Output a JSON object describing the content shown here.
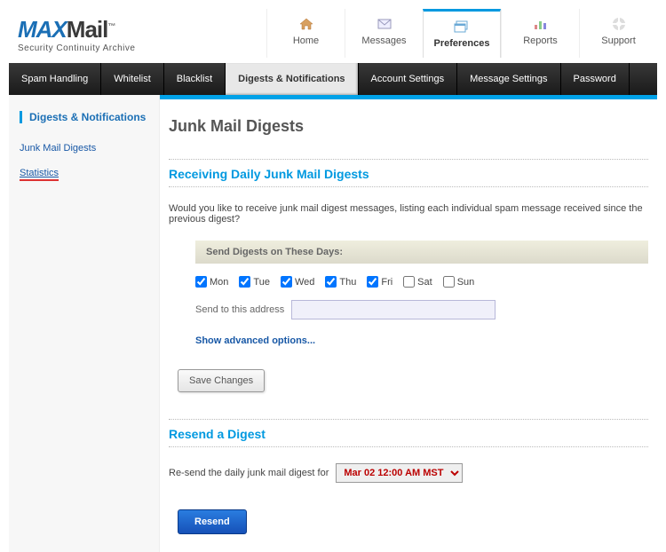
{
  "logo": {
    "part1": "MAX",
    "part2": "Mail",
    "tm": "™",
    "tagline": "Security  Continuity  Archive"
  },
  "topnav": {
    "items": [
      {
        "label": "Home"
      },
      {
        "label": "Messages"
      },
      {
        "label": "Preferences"
      },
      {
        "label": "Reports"
      },
      {
        "label": "Support"
      }
    ]
  },
  "tabs": {
    "items": [
      {
        "label": "Spam Handling"
      },
      {
        "label": "Whitelist"
      },
      {
        "label": "Blacklist"
      },
      {
        "label": "Digests & Notifications"
      },
      {
        "label": "Account Settings"
      },
      {
        "label": "Message Settings"
      },
      {
        "label": "Password"
      }
    ]
  },
  "sidebar": {
    "header": "Digests & Notifications",
    "links": [
      {
        "label": "Junk Mail Digests"
      },
      {
        "label": "Statistics"
      }
    ]
  },
  "page": {
    "title": "Junk Mail Digests"
  },
  "section1": {
    "title": "Receiving Daily Junk Mail Digests",
    "question": "Would you like to receive junk mail digest messages, listing each individual spam message received since the previous digest?",
    "days_header": "Send Digests on These Days:",
    "days": [
      {
        "label": "Mon",
        "checked": true
      },
      {
        "label": "Tue",
        "checked": true
      },
      {
        "label": "Wed",
        "checked": true
      },
      {
        "label": "Thu",
        "checked": true
      },
      {
        "label": "Fri",
        "checked": true
      },
      {
        "label": "Sat",
        "checked": false
      },
      {
        "label": "Sun",
        "checked": false
      }
    ],
    "addr_label": "Send to this address",
    "addr_value": "",
    "adv_link": "Show advanced options...",
    "save_label": "Save Changes"
  },
  "section2": {
    "title": "Resend a Digest",
    "label": "Re-send the daily junk mail digest for",
    "selected": "Mar 02 12:00 AM MST",
    "button": "Resend"
  }
}
